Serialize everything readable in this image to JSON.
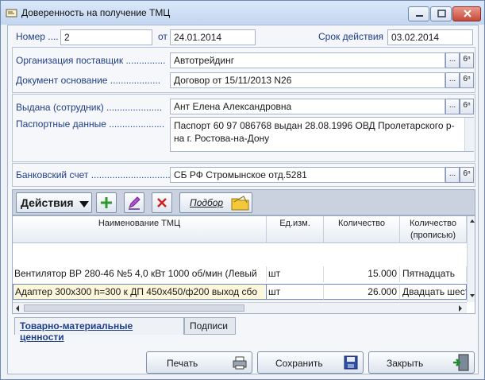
{
  "window": {
    "title": "Доверенность на получение ТМЦ"
  },
  "form": {
    "number_label": "Номер ....",
    "number_value": "2",
    "date_label": "от",
    "date_value": "24.01.2014",
    "valid_label": "Срок действия",
    "valid_value": "03.02.2014",
    "supplier_label": "Организация поставщик ...............",
    "supplier_value": "Автотрейдинг",
    "basis_label": "Документ основание ...................",
    "basis_value": "Договор от 15/11/2013 N26",
    "issued_label": "Выдана (сотрудник) .....................",
    "issued_value": "Ант Елена Александровна",
    "passport_label": "Паспортные данные .....................",
    "passport_value": "Паспорт 60 97 086768 выдан 28.08.1996 ОВД Пролетарского р-на г. Ростова-на-Дону",
    "bank_label": "Банковский счет ................................",
    "bank_value": "СБ РФ Стромынское отд.5281",
    "dots_btn": "...",
    "search_btn": "6ⁿ"
  },
  "toolbar": {
    "actions_label": "Действия",
    "select_label": "Подбор"
  },
  "table": {
    "headers": [
      "Наименование ТМЦ",
      "Ед.изм.",
      "Количество",
      "Количество (прописью)"
    ],
    "rows": [
      [
        "Вентилятор ВР 280-46 №5 4,0 кВт 1000 об/мин (Левый",
        "шт",
        "15.000",
        "Пятнадцать"
      ],
      [
        "Адаптер 300х300 h=300 к ДП 450х450/ф200 выход сбо",
        "шт",
        "26.000",
        "Двадцать шест"
      ]
    ]
  },
  "tabs": [
    "Товарно-материальные ценности",
    "Подписи"
  ],
  "buttons": {
    "print": "Печать",
    "save": "Сохранить",
    "close": "Закрыть"
  },
  "colors": {
    "label": "#1f3e8a",
    "accent_add": "#2e9a2e",
    "accent_delete": "#d02020"
  }
}
